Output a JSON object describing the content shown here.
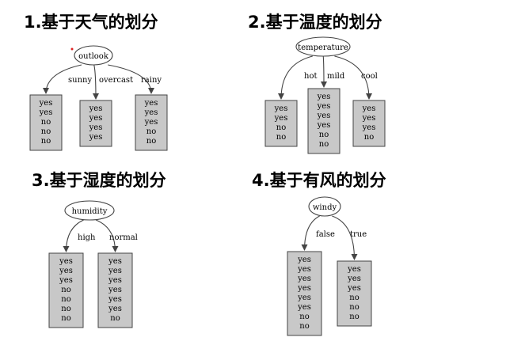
{
  "diagrams": [
    {
      "title": "1.基于天气的划分",
      "root": "outlook",
      "branches": [
        {
          "edge": "sunny",
          "values": [
            "yes",
            "yes",
            "no",
            "no",
            "no"
          ]
        },
        {
          "edge": "overcast",
          "values": [
            "yes",
            "yes",
            "yes",
            "yes"
          ]
        },
        {
          "edge": "rainy",
          "values": [
            "yes",
            "yes",
            "yes",
            "no",
            "no"
          ]
        }
      ]
    },
    {
      "title": "2.基于温度的划分",
      "root": "temperature",
      "branches": [
        {
          "edge": "hot",
          "values": [
            "yes",
            "yes",
            "no",
            "no"
          ]
        },
        {
          "edge": "mild",
          "values": [
            "yes",
            "yes",
            "yes",
            "yes",
            "no",
            "no"
          ]
        },
        {
          "edge": "cool",
          "values": [
            "yes",
            "yes",
            "yes",
            "no"
          ]
        }
      ]
    },
    {
      "title": "3.基于湿度的划分",
      "root": "humidity",
      "branches": [
        {
          "edge": "high",
          "values": [
            "yes",
            "yes",
            "yes",
            "no",
            "no",
            "no",
            "no"
          ]
        },
        {
          "edge": "normal",
          "values": [
            "yes",
            "yes",
            "yes",
            "yes",
            "yes",
            "yes",
            "no"
          ]
        }
      ]
    },
    {
      "title": "4.基于有风的划分",
      "root": "windy",
      "branches": [
        {
          "edge": "false",
          "values": [
            "yes",
            "yes",
            "yes",
            "yes",
            "yes",
            "yes",
            "no",
            "no"
          ]
        },
        {
          "edge": "true",
          "values": [
            "yes",
            "yes",
            "yes",
            "no",
            "no",
            "no"
          ]
        }
      ]
    }
  ],
  "colors": {
    "leaf_fill": "#c8c8c8",
    "stroke": "#444444",
    "text": "#000000"
  }
}
